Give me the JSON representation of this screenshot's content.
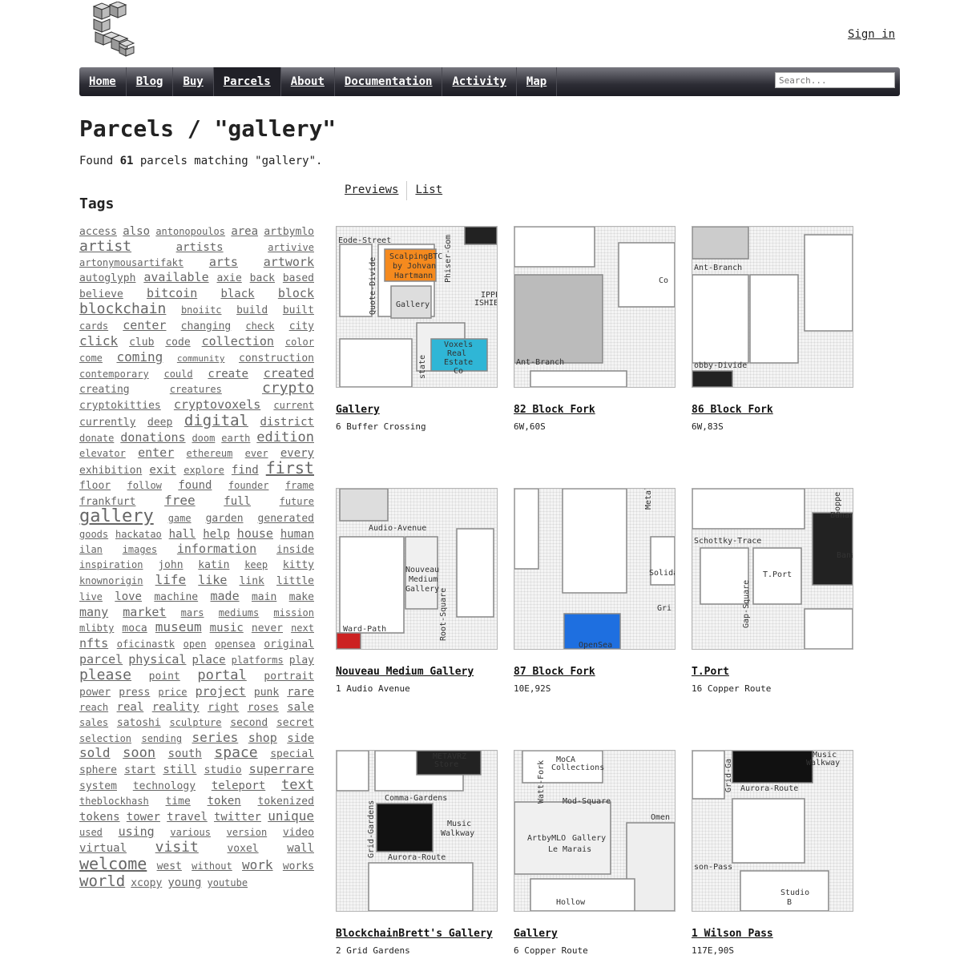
{
  "header": {
    "logo_icon": "cubes-logo-icon",
    "signin_label": "Sign in"
  },
  "nav": {
    "items": [
      {
        "label": "Home",
        "active": false
      },
      {
        "label": "Blog",
        "active": false
      },
      {
        "label": "Buy",
        "active": false
      },
      {
        "label": "Parcels",
        "active": true
      },
      {
        "label": "About",
        "active": false
      },
      {
        "label": "Documentation",
        "active": false
      },
      {
        "label": "Activity",
        "active": false
      },
      {
        "label": "Map",
        "active": false
      }
    ],
    "search_placeholder": "Search..."
  },
  "page": {
    "title": "Parcels / \"gallery\"",
    "found_prefix": "Found ",
    "found_count": "61",
    "found_suffix": " parcels matching \"gallery\"."
  },
  "tags": {
    "heading": "Tags",
    "items": [
      {
        "t": "access",
        "s": 13
      },
      {
        "t": "also",
        "s": 14
      },
      {
        "t": "antonopoulos",
        "s": 12
      },
      {
        "t": "area",
        "s": 14
      },
      {
        "t": "artbymlo",
        "s": 13
      },
      {
        "t": "artist",
        "s": 18
      },
      {
        "t": "artists",
        "s": 14
      },
      {
        "t": "artivive",
        "s": 12
      },
      {
        "t": "artonymousartifakt",
        "s": 12
      },
      {
        "t": "arts",
        "s": 15
      },
      {
        "t": "artwork",
        "s": 15
      },
      {
        "t": "autoglyph",
        "s": 13
      },
      {
        "t": "available",
        "s": 15
      },
      {
        "t": "axie",
        "s": 13
      },
      {
        "t": "back",
        "s": 13
      },
      {
        "t": "based",
        "s": 13
      },
      {
        "t": "believe",
        "s": 13
      },
      {
        "t": "bitcoin",
        "s": 15
      },
      {
        "t": "black",
        "s": 14
      },
      {
        "t": "block",
        "s": 15
      },
      {
        "t": "blockchain",
        "s": 18
      },
      {
        "t": "bnoiitc",
        "s": 12
      },
      {
        "t": "build",
        "s": 13
      },
      {
        "t": "built",
        "s": 13
      },
      {
        "t": "cards",
        "s": 12
      },
      {
        "t": "center",
        "s": 15
      },
      {
        "t": "changing",
        "s": 13
      },
      {
        "t": "check",
        "s": 12
      },
      {
        "t": "city",
        "s": 13
      },
      {
        "t": "click",
        "s": 16
      },
      {
        "t": "club",
        "s": 13
      },
      {
        "t": "code",
        "s": 13
      },
      {
        "t": "collection",
        "s": 15
      },
      {
        "t": "color",
        "s": 12
      },
      {
        "t": "come",
        "s": 12
      },
      {
        "t": "coming",
        "s": 16
      },
      {
        "t": "community",
        "s": 11
      },
      {
        "t": "construction",
        "s": 13
      },
      {
        "t": "contemporary",
        "s": 12
      },
      {
        "t": "could",
        "s": 12
      },
      {
        "t": "create",
        "s": 14
      },
      {
        "t": "created",
        "s": 15
      },
      {
        "t": "creating",
        "s": 13
      },
      {
        "t": "creatures",
        "s": 12
      },
      {
        "t": "crypto",
        "s": 18
      },
      {
        "t": "cryptokitties",
        "s": 13
      },
      {
        "t": "cryptovoxels",
        "s": 15
      },
      {
        "t": "current",
        "s": 12
      },
      {
        "t": "currently",
        "s": 13
      },
      {
        "t": "deep",
        "s": 13
      },
      {
        "t": "digital",
        "s": 19
      },
      {
        "t": "district",
        "s": 14
      },
      {
        "t": "donate",
        "s": 12
      },
      {
        "t": "donations",
        "s": 15
      },
      {
        "t": "doom",
        "s": 12
      },
      {
        "t": "earth",
        "s": 12
      },
      {
        "t": "edition",
        "s": 17
      },
      {
        "t": "elevator",
        "s": 12
      },
      {
        "t": "enter",
        "s": 15
      },
      {
        "t": "ethereum",
        "s": 12
      },
      {
        "t": "ever",
        "s": 12
      },
      {
        "t": "every",
        "s": 14
      },
      {
        "t": "exhibition",
        "s": 13
      },
      {
        "t": "exit",
        "s": 14
      },
      {
        "t": "explore",
        "s": 12
      },
      {
        "t": "find",
        "s": 14
      },
      {
        "t": "first",
        "s": 20
      },
      {
        "t": "floor",
        "s": 13
      },
      {
        "t": "follow",
        "s": 12
      },
      {
        "t": "found",
        "s": 14
      },
      {
        "t": "founder",
        "s": 12
      },
      {
        "t": "frame",
        "s": 12
      },
      {
        "t": "frankfurt",
        "s": 13
      },
      {
        "t": "free",
        "s": 16
      },
      {
        "t": "full",
        "s": 14
      },
      {
        "t": "future",
        "s": 12
      },
      {
        "t": "gallery",
        "s": 22
      },
      {
        "t": "game",
        "s": 12
      },
      {
        "t": "garden",
        "s": 13
      },
      {
        "t": "generated",
        "s": 13
      },
      {
        "t": "goods",
        "s": 12
      },
      {
        "t": "hackatao",
        "s": 12
      },
      {
        "t": "hall",
        "s": 14
      },
      {
        "t": "help",
        "s": 14
      },
      {
        "t": "house",
        "s": 15
      },
      {
        "t": "human",
        "s": 14
      },
      {
        "t": "ilan",
        "s": 12
      },
      {
        "t": "images",
        "s": 12
      },
      {
        "t": "information",
        "s": 15
      },
      {
        "t": "inside",
        "s": 13
      },
      {
        "t": "inspiration",
        "s": 12
      },
      {
        "t": "john",
        "s": 13
      },
      {
        "t": "katin",
        "s": 13
      },
      {
        "t": "keep",
        "s": 12
      },
      {
        "t": "kitty",
        "s": 13
      },
      {
        "t": "knownorigin",
        "s": 12
      },
      {
        "t": "life",
        "s": 16
      },
      {
        "t": "like",
        "s": 15
      },
      {
        "t": "link",
        "s": 13
      },
      {
        "t": "little",
        "s": 13
      },
      {
        "t": "live",
        "s": 12
      },
      {
        "t": "love",
        "s": 14
      },
      {
        "t": "machine",
        "s": 13
      },
      {
        "t": "made",
        "s": 15
      },
      {
        "t": "main",
        "s": 13
      },
      {
        "t": "make",
        "s": 13
      },
      {
        "t": "many",
        "s": 15
      },
      {
        "t": "market",
        "s": 15
      },
      {
        "t": "mars",
        "s": 12
      },
      {
        "t": "mediums",
        "s": 12
      },
      {
        "t": "mission",
        "s": 12
      },
      {
        "t": "mlibty",
        "s": 12
      },
      {
        "t": "moca",
        "s": 13
      },
      {
        "t": "museum",
        "s": 16
      },
      {
        "t": "music",
        "s": 14
      },
      {
        "t": "never",
        "s": 13
      },
      {
        "t": "next",
        "s": 12
      },
      {
        "t": "nfts",
        "s": 15
      },
      {
        "t": "oficinastk",
        "s": 12
      },
      {
        "t": "open",
        "s": 12
      },
      {
        "t": "opensea",
        "s": 12
      },
      {
        "t": "original",
        "s": 13
      },
      {
        "t": "parcel",
        "s": 15
      },
      {
        "t": "physical",
        "s": 15
      },
      {
        "t": "place",
        "s": 14
      },
      {
        "t": "platforms",
        "s": 12
      },
      {
        "t": "play",
        "s": 13
      },
      {
        "t": "please",
        "s": 18
      },
      {
        "t": "point",
        "s": 13
      },
      {
        "t": "portal",
        "s": 17
      },
      {
        "t": "portrait",
        "s": 13
      },
      {
        "t": "power",
        "s": 13
      },
      {
        "t": "press",
        "s": 13
      },
      {
        "t": "price",
        "s": 12
      },
      {
        "t": "project",
        "s": 15
      },
      {
        "t": "punk",
        "s": 13
      },
      {
        "t": "rare",
        "s": 14
      },
      {
        "t": "reach",
        "s": 12
      },
      {
        "t": "real",
        "s": 14
      },
      {
        "t": "reality",
        "s": 14
      },
      {
        "t": "right",
        "s": 13
      },
      {
        "t": "roses",
        "s": 13
      },
      {
        "t": "sale",
        "s": 14
      },
      {
        "t": "sales",
        "s": 12
      },
      {
        "t": "satoshi",
        "s": 13
      },
      {
        "t": "sculpture",
        "s": 12
      },
      {
        "t": "second",
        "s": 13
      },
      {
        "t": "secret",
        "s": 13
      },
      {
        "t": "selection",
        "s": 12
      },
      {
        "t": "sending",
        "s": 12
      },
      {
        "t": "series",
        "s": 16
      },
      {
        "t": "shop",
        "s": 15
      },
      {
        "t": "side",
        "s": 14
      },
      {
        "t": "sold",
        "s": 16
      },
      {
        "t": "soon",
        "s": 17
      },
      {
        "t": "south",
        "s": 14
      },
      {
        "t": "space",
        "s": 18
      },
      {
        "t": "special",
        "s": 13
      },
      {
        "t": "sphere",
        "s": 13
      },
      {
        "t": "start",
        "s": 13
      },
      {
        "t": "still",
        "s": 14
      },
      {
        "t": "studio",
        "s": 13
      },
      {
        "t": "superrare",
        "s": 15
      },
      {
        "t": "system",
        "s": 13
      },
      {
        "t": "technology",
        "s": 13
      },
      {
        "t": "teleport",
        "s": 14
      },
      {
        "t": "text",
        "s": 17
      },
      {
        "t": "theblockhash",
        "s": 12
      },
      {
        "t": "time",
        "s": 13
      },
      {
        "t": "token",
        "s": 14
      },
      {
        "t": "tokenized",
        "s": 13
      },
      {
        "t": "tokens",
        "s": 14
      },
      {
        "t": "tower",
        "s": 14
      },
      {
        "t": "travel",
        "s": 14
      },
      {
        "t": "twitter",
        "s": 14
      },
      {
        "t": "unique",
        "s": 16
      },
      {
        "t": "used",
        "s": 12
      },
      {
        "t": "using",
        "s": 15
      },
      {
        "t": "various",
        "s": 12
      },
      {
        "t": "version",
        "s": 12
      },
      {
        "t": "video",
        "s": 13
      },
      {
        "t": "virtual",
        "s": 14
      },
      {
        "t": "visit",
        "s": 18
      },
      {
        "t": "voxel",
        "s": 13
      },
      {
        "t": "wall",
        "s": 14
      },
      {
        "t": "welcome",
        "s": 20
      },
      {
        "t": "west",
        "s": 13
      },
      {
        "t": "without",
        "s": 12
      },
      {
        "t": "work",
        "s": 16
      },
      {
        "t": "works",
        "s": 13
      },
      {
        "t": "world",
        "s": 19
      },
      {
        "t": "xcopy",
        "s": 13
      },
      {
        "t": "young",
        "s": 14
      },
      {
        "t": "youtube",
        "s": 12
      }
    ]
  },
  "view_tabs": [
    "Previews",
    "List"
  ],
  "parcels": [
    {
      "name": "Gallery",
      "address": "6 Buffer Crossing",
      "map_labels": [
        "Eode-Street",
        "Quote-Divide",
        "Phiser-Gom",
        "ScalpingBTC",
        "by Johvan",
        "Hartmann",
        "Gallery",
        "IPPE",
        "ISHIBA",
        "Voxels",
        "Real",
        "Estate",
        "Co",
        "state"
      ]
    },
    {
      "name": "82 Block Fork",
      "address": "6W,60S",
      "map_labels": [
        "Ant-Branch",
        "Co"
      ]
    },
    {
      "name": "86 Block Fork",
      "address": "6W,83S",
      "map_labels": [
        "Ant-Branch",
        "obby-Divide"
      ]
    },
    {
      "name": "Nouveau Medium Gallery",
      "address": "1 Audio Avenue",
      "map_labels": [
        "Audio-Avenue",
        "Nouveau",
        "Medium",
        "Gallery",
        "Ward-Path",
        "Root-Square"
      ]
    },
    {
      "name": "87 Block Fork",
      "address": "10E,92S",
      "map_labels": [
        "Metal",
        "Solida",
        "Gri",
        "OpenSea"
      ]
    },
    {
      "name": "T.Port",
      "address": "16 Copper Route",
      "map_labels": [
        "Schottky-Trace",
        "T.Port",
        "Gap-Square",
        "Goppe",
        "Banana",
        "Bana"
      ]
    },
    {
      "name": "BlockchainBrett's Gallery",
      "address": "2 Grid Gardens",
      "map_labels": [
        "Comma-Gardens",
        "Grid-Gardens",
        "Music",
        "Walkway",
        "Aurora-Route",
        "METAVRZ",
        "Store"
      ]
    },
    {
      "name": "Gallery",
      "address": "6 Copper Route",
      "map_labels": [
        "MoCA",
        "Collections",
        "Watt-Fork",
        "Mod-Square",
        "ArtbyMLO",
        "Gallery",
        "Le Marais",
        "Omen",
        "Hollow"
      ]
    },
    {
      "name": "1 Wilson Pass",
      "address": "117E,90S",
      "map_labels": [
        "Grid-Ga",
        "Music",
        "Walkway",
        "Aurora-Route",
        "son-Pass",
        "Studio",
        "B"
      ]
    }
  ]
}
